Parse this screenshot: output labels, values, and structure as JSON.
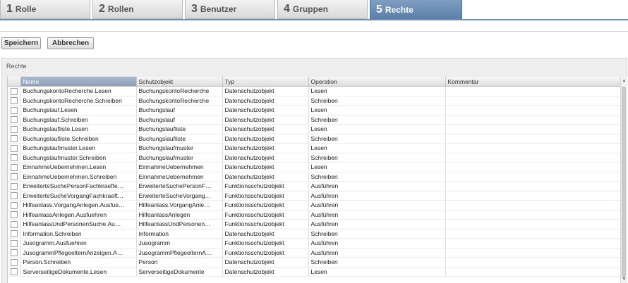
{
  "tabs": [
    {
      "num": "1",
      "label": "Rolle"
    },
    {
      "num": "2",
      "label": "Rollen"
    },
    {
      "num": "3",
      "label": "Benutzer"
    },
    {
      "num": "4",
      "label": "Gruppen"
    },
    {
      "num": "5",
      "label": "Rechte",
      "active": true
    }
  ],
  "toolbar": {
    "save_label": "Speichern",
    "cancel_label": "Abbrechen"
  },
  "panel": {
    "title": "Rechte"
  },
  "grid": {
    "columns": [
      "Name",
      "Schutzobjekt",
      "Typ",
      "Operation",
      "Kommentar"
    ],
    "rows": [
      [
        "BuchungskontoRecherche.Lesen",
        "BuchungskontoRecherche",
        "Datenschutzobjekt",
        "Lesen",
        ""
      ],
      [
        "BuchungskontoRecherche.Schreiben",
        "BuchungskontoRecherche",
        "Datenschutzobjekt",
        "Schreiben",
        ""
      ],
      [
        "Buchungslauf.Lesen",
        "Buchungslauf",
        "Datenschutzobjekt",
        "Lesen",
        ""
      ],
      [
        "Buchungslauf.Schreiben",
        "Buchungslauf",
        "Datenschutzobjekt",
        "Schreiben",
        ""
      ],
      [
        "Buchungslaufliste.Lesen",
        "Buchungslaufliste",
        "Datenschutzobjekt",
        "Lesen",
        ""
      ],
      [
        "Buchungslaufliste.Schreiben",
        "Buchungslaufliste",
        "Datenschutzobjekt",
        "Schreiben",
        ""
      ],
      [
        "Buchungslaufmuster.Lesen",
        "Buchungslaufmuster",
        "Datenschutzobjekt",
        "Lesen",
        ""
      ],
      [
        "Buchungslaufmuster.Schreiben",
        "Buchungslaufmuster",
        "Datenschutzobjekt",
        "Schreiben",
        ""
      ],
      [
        "EinnahmeUebernehmen.Lesen",
        "EinnahmeUebernehmen",
        "Datenschutzobjekt",
        "Lesen",
        ""
      ],
      [
        "EinnahmeUebernehmen.Schreiben",
        "EinnahmeUebernehmen",
        "Datenschutzobjekt",
        "Schreiben",
        ""
      ],
      [
        "ErweiterteSuchePersonFachkraefte…",
        "ErweiterteSuchePersonF…",
        "Funktionsschutzobjekt",
        "Ausführen",
        ""
      ],
      [
        "ErweiterteSucheVorgangFachkraeft…",
        "ErweiterteSucheVorgang…",
        "Funktionsschutzobjekt",
        "Ausführen",
        ""
      ],
      [
        "Hilfeanlass.VorgangAnlegen.Ausfue…",
        "Hilfeanlass.VorgangAnle…",
        "Funktionsschutzobjekt",
        "Ausführen",
        ""
      ],
      [
        "HilfeanlassAnlegen.Ausfuehren",
        "HilfeanlassAnlegen",
        "Funktionsschutzobjekt",
        "Ausführen",
        ""
      ],
      [
        "HilfeanlassUndPersonenSuche.Au…",
        "HilfeanlassUndPersonen…",
        "Funktionsschutzobjekt",
        "Ausführen",
        ""
      ],
      [
        "Information.Schreiben",
        "Information",
        "Datenschutzobjekt",
        "Schreiben",
        ""
      ],
      [
        "Jusogramm.Ausfuehren",
        "Jusogramm",
        "Funktionsschutzobjekt",
        "Ausführen",
        ""
      ],
      [
        "JusogrammPflegeelternAnzeigen.A…",
        "JusogrammPflegeelternA…",
        "Funktionsschutzobjekt",
        "Ausführen",
        ""
      ],
      [
        "Person.Schreiben",
        "Person",
        "Datenschutzobjekt",
        "Schreiben",
        ""
      ],
      [
        "ServerseitigeDokumente.Lesen",
        "ServerseitigeDokumente",
        "Datenschutzobjekt",
        "Lesen",
        ""
      ]
    ]
  },
  "colors": {
    "accent": "#6f8fb5",
    "active_tab": "#5b7fa8",
    "sorted_header": "#97a8c0"
  }
}
